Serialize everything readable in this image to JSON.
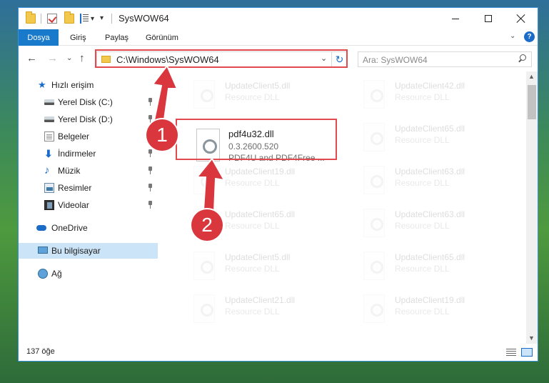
{
  "window": {
    "title": "SysWOW64",
    "quick_access_dropdown": "▾"
  },
  "ribbon": {
    "tabs": [
      "Dosya",
      "Giriş",
      "Paylaş",
      "Görünüm"
    ],
    "help": "?"
  },
  "address_bar": {
    "path": "C:\\Windows\\SysWOW64",
    "search_placeholder": "Ara: SysWOW64"
  },
  "sidebar": {
    "items": [
      {
        "label": "Hızlı erişim",
        "icon": "star-icon",
        "pinned": false
      },
      {
        "label": "Yerel Disk (C:)",
        "icon": "drive-icon",
        "pinned": true
      },
      {
        "label": "Yerel Disk (D:)",
        "icon": "drive-icon",
        "pinned": true
      },
      {
        "label": "Belgeler",
        "icon": "documents-icon",
        "pinned": true
      },
      {
        "label": "İndirmeler",
        "icon": "download-icon",
        "pinned": true
      },
      {
        "label": "Müzik",
        "icon": "music-icon",
        "pinned": true
      },
      {
        "label": "Resimler",
        "icon": "pictures-icon",
        "pinned": true
      },
      {
        "label": "Videolar",
        "icon": "videos-icon",
        "pinned": true
      },
      {
        "label": "OneDrive",
        "icon": "cloud-icon",
        "pinned": false
      },
      {
        "label": "Bu bilgisayar",
        "icon": "computer-icon",
        "pinned": false,
        "selected": true
      },
      {
        "label": "Ağ",
        "icon": "network-icon",
        "pinned": false
      }
    ]
  },
  "files": {
    "focused": {
      "name": "pdf4u32.dll",
      "version": "0.3.2600.520",
      "description": "PDF4U and PDF4Free ..."
    },
    "background": [
      {
        "name": "UpdateClient5.dll",
        "type": "Resource DLL"
      },
      {
        "name": "UpdateClient42.dll",
        "type": "Resource DLL"
      },
      {
        "name": "UpdateClient65.dll",
        "type": "Resource DLL"
      },
      {
        "name": "UpdateClient19.dll",
        "type": "Resource DLL"
      },
      {
        "name": "UpdateClient63.dll",
        "type": "Resource DLL"
      },
      {
        "name": "UpdateClient65.dll",
        "type": "Resource DLL"
      },
      {
        "name": "UpdateClient63.dll",
        "type": "Resource DLL"
      },
      {
        "name": "UpdateClient5.dll",
        "type": "Resource DLL"
      },
      {
        "name": "UpdateClient65.dll",
        "type": "Resource DLL"
      },
      {
        "name": "UpdateClient21.dll",
        "type": "Resource DLL"
      },
      {
        "name": "UpdateClient19.dll",
        "type": "Resource DLL"
      }
    ]
  },
  "status": {
    "item_count": "137 öğe"
  },
  "annotations": {
    "step1": "1",
    "step2": "2",
    "color": "#e14b50"
  }
}
